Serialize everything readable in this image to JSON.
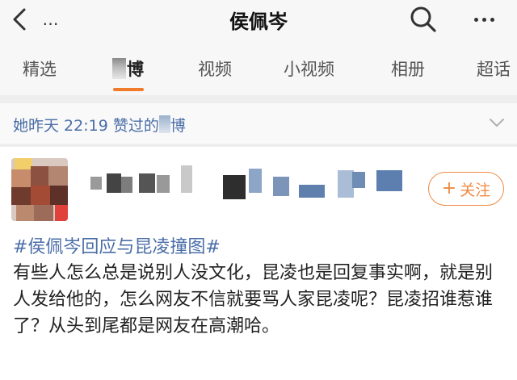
{
  "topbar": {
    "title": "侯佩岑",
    "more_left": "…"
  },
  "tabs": [
    {
      "label": "精选",
      "active": false
    },
    {
      "label": "博",
      "active": true
    },
    {
      "label": "视频",
      "active": false
    },
    {
      "label": "小视频",
      "active": false
    },
    {
      "label": "相册",
      "active": false
    },
    {
      "label": "超话",
      "active": false
    }
  ],
  "liked_bar": {
    "prefix": "她昨天 22:19 赞过的",
    "suffix": "博"
  },
  "post": {
    "follow_label": "关注",
    "follow_plus": "+",
    "hashtag": "#侯佩岑回应与昆凌撞图#",
    "body": "有些人怎么总是说别人没文化，昆凌也是回复事实啊，就是别人发给他的，怎么网友不信就要骂人家昆凌呢？昆凌招谁惹谁了？从头到尾都是网友在高潮哈。"
  },
  "colors": {
    "accent": "#f07c2a",
    "link": "#4a6ea8",
    "follow": "#f08b44"
  },
  "icons": [
    "back-arrow-icon",
    "more-dots-icon",
    "search-icon",
    "chevron-down-icon"
  ]
}
